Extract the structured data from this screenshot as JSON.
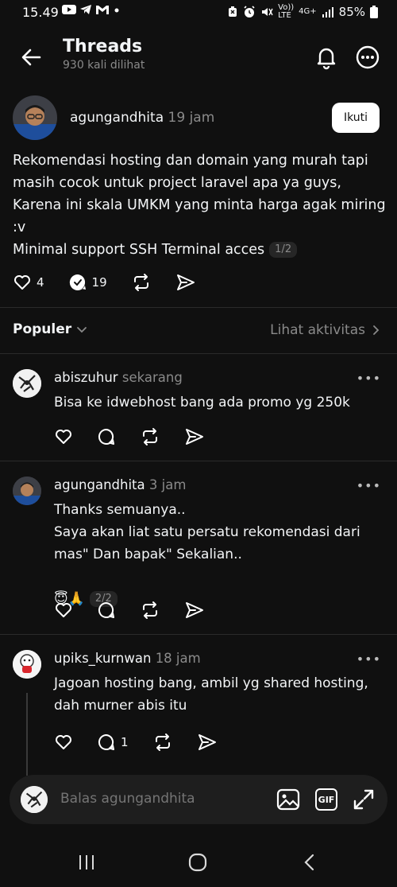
{
  "status_bar": {
    "time": "15.49",
    "battery": "85%",
    "network": "4G+",
    "volte": "Vo)) LTE"
  },
  "header": {
    "title": "Threads",
    "views": "930 kali dilihat"
  },
  "post": {
    "username": "agungandhita",
    "time": "19 jam",
    "follow_label": "Ikuti",
    "text": "Rekomendasi hosting dan domain yang murah tapi masih cocok untuk project laravel apa ya guys, Karena ini skala UMKM yang minta harga agak miring :v\nMinimal support SSH Terminal acces",
    "page_indicator": "1/2",
    "likes": "4",
    "replies": "19"
  },
  "sort": {
    "label": "Populer",
    "activity_link": "Lihat aktivitas"
  },
  "replies": [
    {
      "username": "abiszuhur",
      "time": "sekarang",
      "text": "Bisa ke idwebhost bang ada promo yg 250k",
      "reply_count": ""
    },
    {
      "username": "agungandhita",
      "time": "3 jam",
      "text": "Thanks semuanya..\nSaya akan liat satu persatu rekomendasi dari mas\" Dan bapak\" Sekalian..",
      "emoji": "😇🙏",
      "page_indicator": "2/2",
      "reply_count": ""
    },
    {
      "username": "upiks_kurnwan",
      "time": "18 jam",
      "text": "Jagoan hosting bang, ambil yg shared hosting, dah murner abis itu",
      "reply_count": "1"
    }
  ],
  "reply_bar": {
    "placeholder": "Balas agungandhita",
    "gif_label": "GIF"
  },
  "more_label": "•••"
}
